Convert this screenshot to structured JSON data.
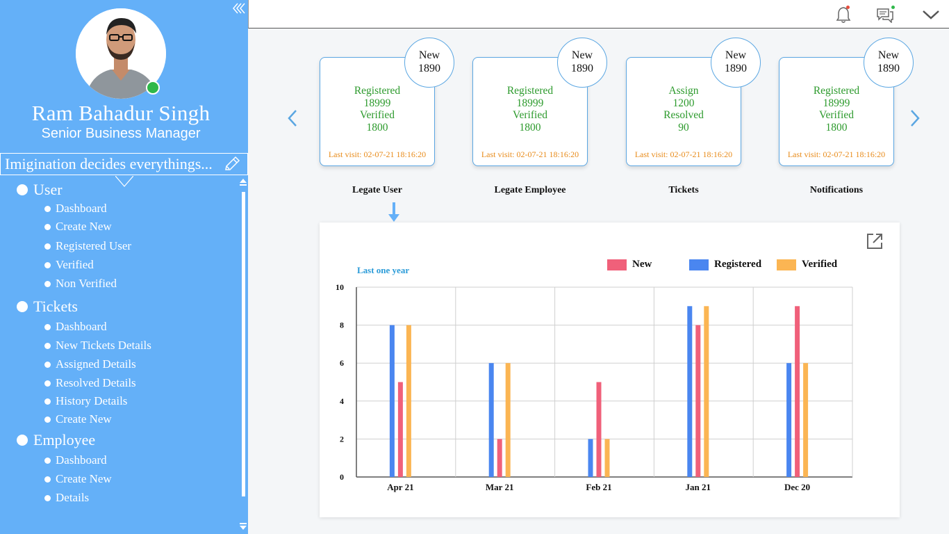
{
  "sidebar": {
    "user_name": "Ram Bahadur Singh",
    "user_role": "Senior Business Manager",
    "status": "online",
    "motto": "Imigination decides everythings...",
    "groups": [
      {
        "label": "User",
        "items": [
          "Dashboard",
          "Create New",
          "Registered User",
          "Verified",
          "Non Verified"
        ]
      },
      {
        "label": "Tickets",
        "items": [
          "Dashboard",
          "New Tickets Details",
          "Assigned Details",
          "Resolved Details",
          "History Details",
          "Create New"
        ]
      },
      {
        "label": "Employee",
        "items": [
          "Dashboard",
          "Create New",
          "Details"
        ]
      }
    ]
  },
  "topbar": {
    "icons": [
      "bell-icon",
      "chat-icon",
      "chevron-down-icon"
    ],
    "badge_colors": {
      "bell": "#e74c3c",
      "chat": "#2fb84a"
    }
  },
  "cards": [
    {
      "badge_label": "New",
      "badge_value": "1890",
      "line1": "Registered",
      "line2": "18999",
      "line3": "Verified",
      "line4": "1800",
      "last_visit": "Last visit: 02-07-21 18:16:20",
      "title": "Legate User"
    },
    {
      "badge_label": "New",
      "badge_value": "1890",
      "line1": "Registered",
      "line2": "18999",
      "line3": "Verified",
      "line4": "1800",
      "last_visit": "Last visit: 02-07-21 18:16:20",
      "title": "Legate Employee"
    },
    {
      "badge_label": "New",
      "badge_value": "1890",
      "line1": "Assign",
      "line2": "1200",
      "line3": "Resolved",
      "line4": "90",
      "last_visit": "Last visit: 02-07-21 18:16:20",
      "title": "Tickets"
    },
    {
      "badge_label": "New",
      "badge_value": "1890",
      "line1": "Registered",
      "line2": "18999",
      "line3": "Verified",
      "line4": "1800",
      "last_visit": "Last visit: 02-07-21 18:16:20",
      "title": "Notifications"
    }
  ],
  "chart_data": {
    "type": "bar",
    "title": "Last one year",
    "categories": [
      "Apr 21",
      "Mar 21",
      "Feb 21",
      "Jan 21",
      "Dec 20"
    ],
    "series": [
      {
        "name": "Registered",
        "color": "#4a86f0",
        "values": [
          8,
          6,
          2,
          9,
          6
        ]
      },
      {
        "name": "New",
        "color": "#f0607a",
        "values": [
          5,
          2,
          5,
          8,
          9
        ]
      },
      {
        "name": "Verified",
        "color": "#fbb553",
        "values": [
          8,
          6,
          2,
          9,
          6
        ]
      }
    ],
    "legend_order": [
      "New",
      "Registered",
      "Verified"
    ],
    "yticks": [
      0,
      2,
      4,
      6,
      8,
      10
    ],
    "ylim": [
      0,
      10
    ],
    "grid": true,
    "legend_position": "top-right"
  }
}
